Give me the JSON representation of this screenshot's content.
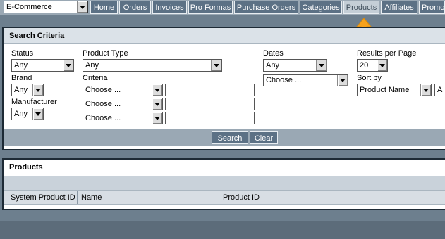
{
  "module_select": {
    "value": "E-Commerce"
  },
  "nav": {
    "tabs": [
      {
        "id": "home",
        "label": "Home"
      },
      {
        "id": "orders",
        "label": "Orders"
      },
      {
        "id": "invoices",
        "label": "Invoices"
      },
      {
        "id": "pro-formas",
        "label": "Pro Formas"
      },
      {
        "id": "purchase-orders",
        "label": "Purchase Orders"
      },
      {
        "id": "categories",
        "label": "Categories"
      },
      {
        "id": "products",
        "label": "Products",
        "active": true
      },
      {
        "id": "affiliates",
        "label": "Affiliates"
      },
      {
        "id": "promotions",
        "label": "Promoti"
      }
    ]
  },
  "search_criteria": {
    "title": "Search Criteria",
    "status": {
      "label": "Status",
      "value": "Any"
    },
    "product_type": {
      "label": "Product Type",
      "value": "Any"
    },
    "brand": {
      "label": "Brand",
      "value": "Any"
    },
    "criteria": {
      "label": "Criteria",
      "rows": [
        {
          "field": "Choose ...",
          "text": ""
        },
        {
          "field": "Choose ...",
          "text": ""
        },
        {
          "field": "Choose ...",
          "text": ""
        }
      ]
    },
    "manufacturer": {
      "label": "Manufacturer",
      "value": "Any"
    },
    "dates": {
      "label": "Dates",
      "value": "Any",
      "second_value": "Choose ..."
    },
    "results_per_page": {
      "label": "Results per Page",
      "value": "20"
    },
    "sort_by": {
      "label": "Sort by",
      "value": "Product Name",
      "order_value": "A"
    },
    "search_button": "Search",
    "clear_button": "Clear"
  },
  "products": {
    "title": "Products",
    "columns": [
      "System Product ID",
      "Name",
      "Product ID"
    ]
  }
}
